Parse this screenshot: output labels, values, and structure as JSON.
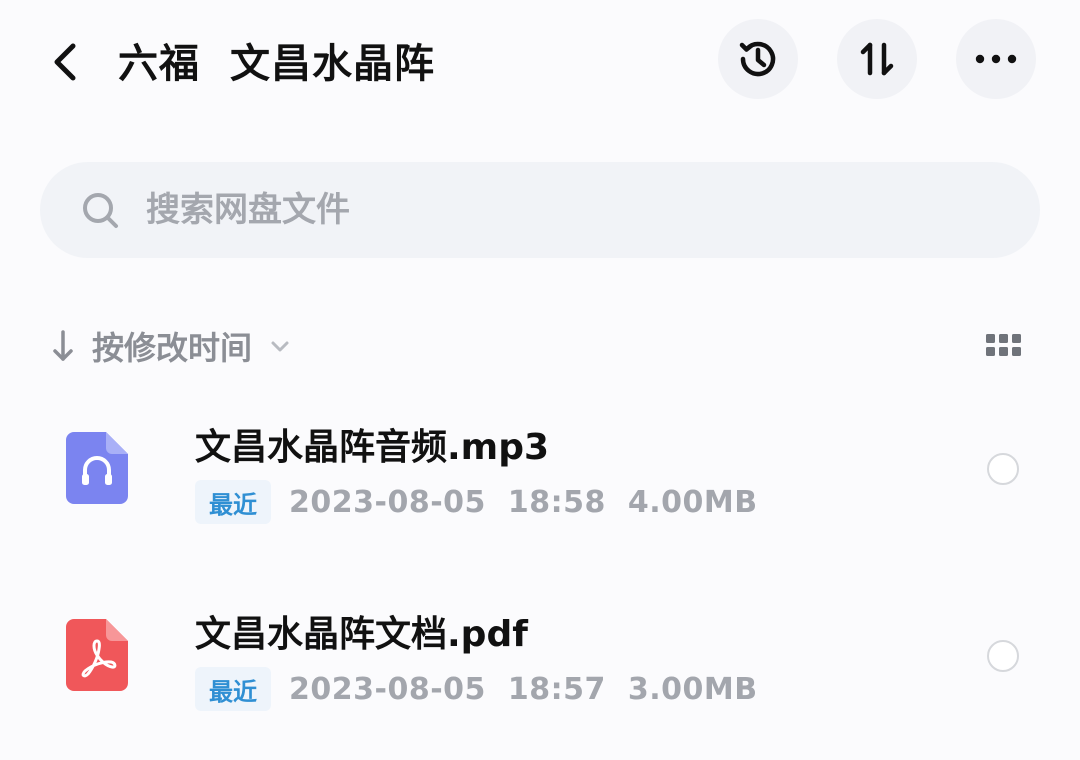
{
  "header": {
    "title_part1": "六福",
    "title_part2": "文昌水晶阵"
  },
  "search": {
    "placeholder": "搜索网盘文件"
  },
  "sort": {
    "label": "按修改时间"
  },
  "files": [
    {
      "name": "文昌水晶阵音频.mp3",
      "badge": "最近",
      "date": "2023-08-05",
      "time": "18:58",
      "size": "4.00MB",
      "icon": "audio-file-icon",
      "icon_color": "#7b84f0"
    },
    {
      "name": "文昌水晶阵文档.pdf",
      "badge": "最近",
      "date": "2023-08-05",
      "time": "18:57",
      "size": "3.00MB",
      "icon": "pdf-file-icon",
      "icon_color": "#f0575a"
    }
  ],
  "colors": {
    "badge_text": "#2f8fd3",
    "meta_text": "#a3a6ad",
    "button_bg": "#f1f2f6"
  }
}
